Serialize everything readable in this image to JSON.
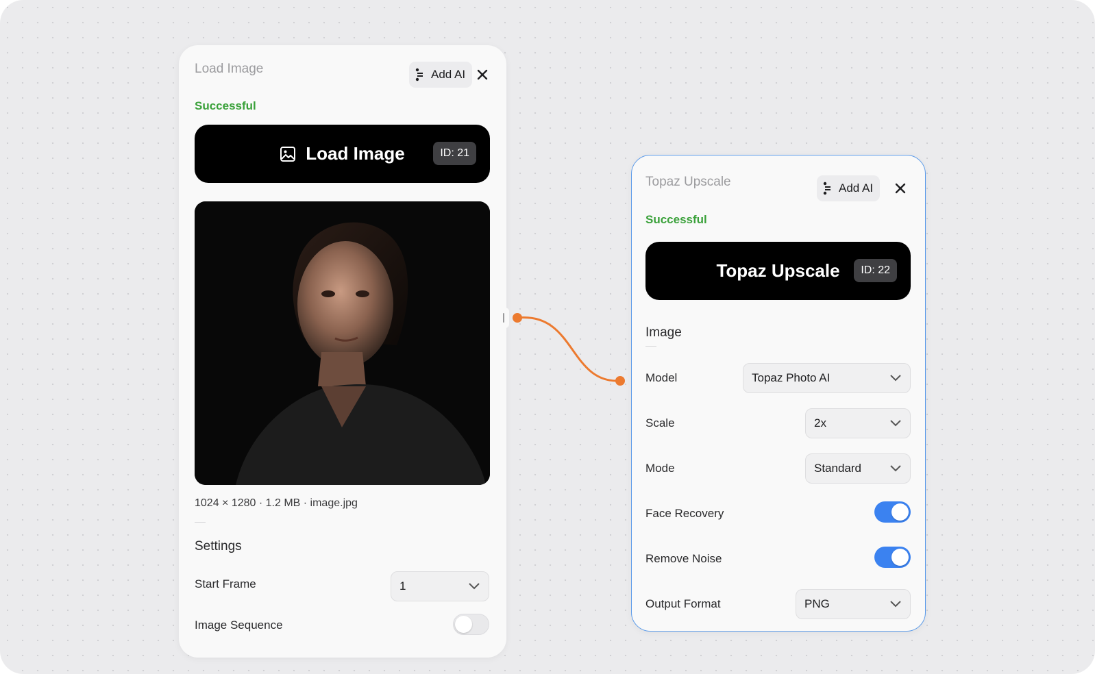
{
  "load_node": {
    "title": "Load Image",
    "add_ai_label": "Add AI",
    "status": "Successful",
    "banner_label": "Load Image",
    "id_badge": "ID: 21",
    "file_info": "1024 × 1280 · 1.2 MB · image.jpg",
    "settings_heading": "Settings",
    "start_frame_label": "Start Frame",
    "start_frame_value": "1",
    "image_sequence_label": "Image Sequence",
    "image_sequence_on": false
  },
  "topaz_node": {
    "title": "Topaz Upscale",
    "add_ai_label": "Add AI",
    "status": "Successful",
    "banner_label": "Topaz Upscale",
    "id_badge": "ID: 22",
    "image_heading": "Image",
    "model_label": "Model",
    "model_value": "Topaz Photo AI",
    "scale_label": "Scale",
    "scale_value": "2x",
    "mode_label": "Mode",
    "mode_value": "Standard",
    "face_recovery_label": "Face Recovery",
    "face_recovery_on": true,
    "remove_noise_label": "Remove Noise",
    "remove_noise_on": true,
    "output_format_label": "Output Format",
    "output_format_value": "PNG"
  },
  "colors": {
    "status_green": "#3aa13a",
    "toggle_on": "#3b82f0",
    "connector_orange": "#ec7a2f",
    "node_border_selected": "#5b9bea"
  }
}
